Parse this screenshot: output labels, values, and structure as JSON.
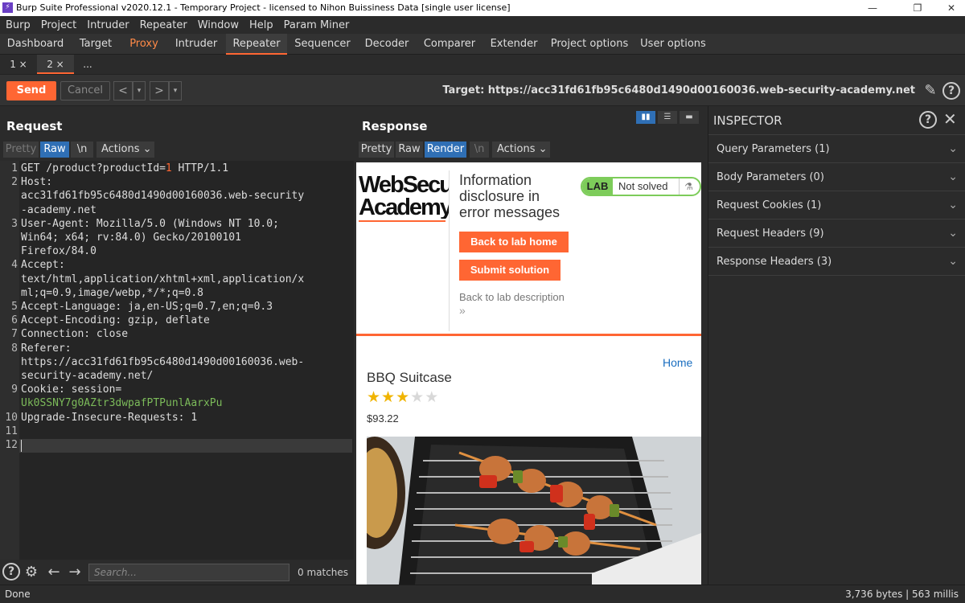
{
  "window": {
    "title": "Burp Suite Professional v2020.12.1 - Temporary Project - licensed to Nihon Buissiness Data [single user license]"
  },
  "menu": [
    "Burp",
    "Project",
    "Intruder",
    "Repeater",
    "Window",
    "Help",
    "Param Miner"
  ],
  "main_tabs": [
    "Dashboard",
    "Target",
    "Proxy",
    "Intruder",
    "Repeater",
    "Sequencer",
    "Decoder",
    "Comparer",
    "Extender",
    "Project options",
    "User options"
  ],
  "sub_tabs": {
    "tab1": "1 ×",
    "tab2": "2 ×",
    "more": "..."
  },
  "toolbar": {
    "send": "Send",
    "cancel": "Cancel",
    "target_label": "Target: https://acc31fd61fb95c6480d1490d00160036.web-security-academy.net"
  },
  "request": {
    "title": "Request",
    "tabs": {
      "pretty": "Pretty",
      "raw": "Raw",
      "newline": "\\n",
      "actions": "Actions"
    },
    "lines": [
      {
        "n": "1",
        "text": "GET /product?productId="
      },
      {
        "n": "",
        "num": "1",
        "tail": " HTTP/1.1"
      },
      {
        "n": "2",
        "text": "Host:"
      },
      {
        "n": "",
        "text": "acc31fd61fb95c6480d1490d00160036.web-security"
      },
      {
        "n": "",
        "text": "-academy.net"
      },
      {
        "n": "3",
        "text": "User-Agent: Mozilla/5.0 (Windows NT 10.0;"
      },
      {
        "n": "",
        "text": "Win64; x64; rv:84.0) Gecko/20100101"
      },
      {
        "n": "",
        "text": "Firefox/84.0"
      },
      {
        "n": "4",
        "text": "Accept:"
      },
      {
        "n": "",
        "text": "text/html,application/xhtml+xml,application/x"
      },
      {
        "n": "",
        "text": "ml;q=0.9,image/webp,*/*;q=0.8"
      },
      {
        "n": "5",
        "text": "Accept-Language: ja,en-US;q=0.7,en;q=0.3"
      },
      {
        "n": "6",
        "text": "Accept-Encoding: gzip, deflate"
      },
      {
        "n": "7",
        "text": "Connection: close"
      },
      {
        "n": "8",
        "text": "Referer:"
      },
      {
        "n": "",
        "text": "https://acc31fd61fb95c6480d1490d00160036.web-"
      },
      {
        "n": "",
        "text": "security-academy.net/"
      },
      {
        "n": "9",
        "text": "Cookie: session="
      },
      {
        "n": "",
        "text": "Uk0SSNY7g0AZtr3dwpafPTPunlAarxPu"
      },
      {
        "n": "10",
        "text": "Upgrade-Insecure-Requests: 1"
      },
      {
        "n": "11",
        "text": ""
      },
      {
        "n": "12",
        "text": ""
      }
    ],
    "search_placeholder": "Search...",
    "matches": "0 matches"
  },
  "response": {
    "title": "Response",
    "tabs": {
      "pretty": "Pretty",
      "raw": "Raw",
      "render": "Render",
      "newline": "\\n",
      "actions": "Actions"
    },
    "page": {
      "logo_line1": "WebSecu",
      "logo_line2": "Academy",
      "lab_title_1": "Information",
      "lab_title_2": "disclosure in",
      "lab_title_3": "error messages",
      "lab_badge": "LAB",
      "lab_status": "Not solved",
      "back_home": "Back to lab home",
      "submit": "Submit solution",
      "back_desc": "Back to lab description",
      "chevrons": "»",
      "home_link": "Home",
      "product_name": "BBQ Suitcase",
      "rating": 3,
      "stars_max": 5,
      "price": "$93.22"
    }
  },
  "inspector": {
    "title": "INSPECTOR",
    "sections": [
      "Query Parameters (1)",
      "Body Parameters (0)",
      "Request Cookies (1)",
      "Request Headers (9)",
      "Response Headers (3)"
    ]
  },
  "status": {
    "left": "Done",
    "right": "3,736 bytes | 563 millis"
  },
  "colors": {
    "accent": "#ff6633",
    "selected_tab": "#2f6fb5",
    "cookie_value": "#7cbb5a"
  }
}
